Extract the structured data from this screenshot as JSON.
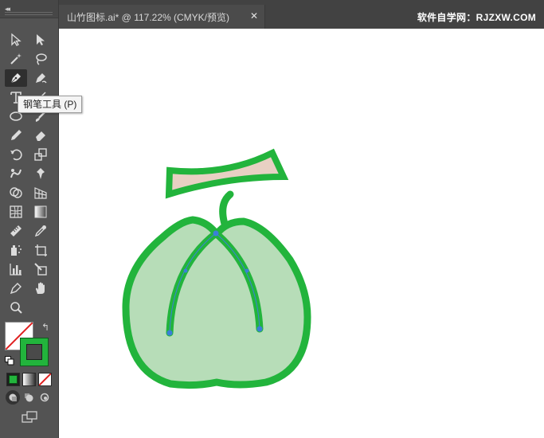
{
  "document_tab": {
    "title": "山竹图标.ai* @ 117.22% (CMYK/预览)",
    "close_glyph": "✕"
  },
  "watermark": "软件自学网：RJZXW.COM",
  "tooltip": "钢笔工具 (P)",
  "toolbar": {
    "collapse_glyph": "◂◂",
    "swap_glyph": "↰",
    "active_tool": "pen-tool",
    "tools": [
      "selection-tool-icon",
      "direct-selection-tool-icon",
      "magic-wand-tool-icon",
      "lasso-tool-icon",
      "pen-tool-icon",
      "curvature-tool-icon",
      "type-tool-icon",
      "line-segment-tool-icon",
      "ellipse-tool-icon",
      "paintbrush-tool-icon",
      "pencil-tool-icon",
      "eraser-tool-icon",
      "rotate-tool-icon",
      "scale-tool-icon",
      "warp-tool-icon",
      "puppet-warp-tool-icon",
      "shape-builder-tool-icon",
      "perspective-grid-tool-icon",
      "mesh-tool-icon",
      "gradient-tool-icon",
      "measure-tool-icon",
      "eyedropper-tool-icon",
      "symbol-sprayer-tool-icon",
      "artboard-tool-icon",
      "column-graph-tool-icon",
      "slice-tool-icon",
      "eyedropper-alt-tool-icon",
      "hand-tool-icon",
      "zoom-tool-icon"
    ]
  },
  "colors": {
    "stroke": "#22b43c",
    "fruit_fill": "#b7ddb8",
    "stem_fill": "#e8d0c3",
    "anchor_point": "#3b7fd8",
    "toolbar_bg": "#535353",
    "canvas_bg": "#ffffff"
  }
}
